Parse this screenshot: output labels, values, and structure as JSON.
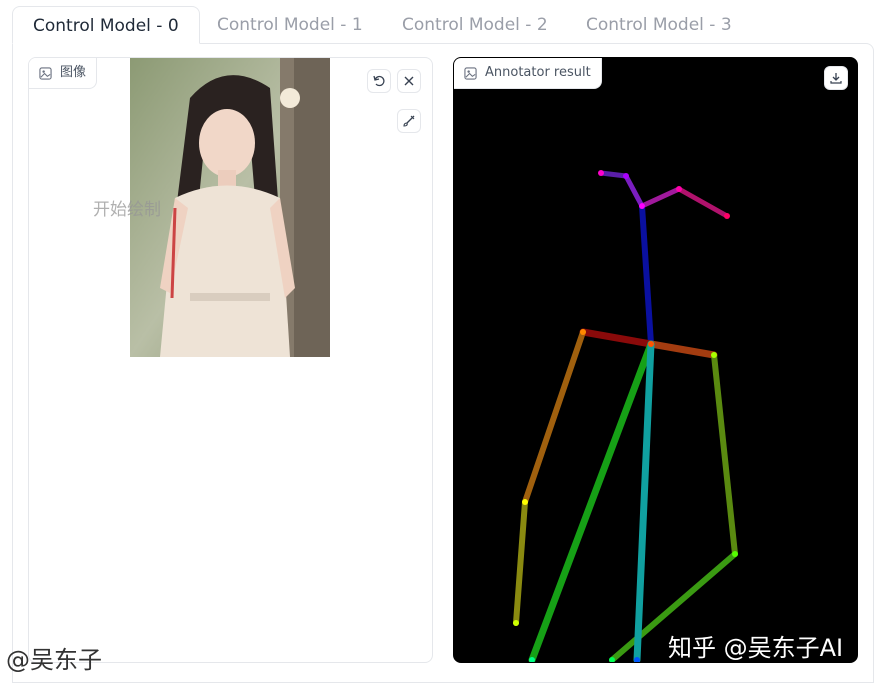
{
  "tabs": [
    {
      "label": "Control Model - 0",
      "active": true
    },
    {
      "label": "Control Model - 1",
      "active": false
    },
    {
      "label": "Control Model - 2",
      "active": false
    },
    {
      "label": "Control Model - 3",
      "active": false
    }
  ],
  "image_panel": {
    "label": "图像",
    "overlay_text": "开始绘制"
  },
  "result_panel": {
    "label": "Annotator result"
  },
  "watermarks": {
    "bottom_left": "@吴东子",
    "bottom_right": "知乎 @吴东子AI"
  },
  "colors": {
    "active_tab_text": "#1f2937",
    "inactive_tab_text": "#9a9ea8",
    "border": "#e5e7eb",
    "result_background": "#000000"
  }
}
